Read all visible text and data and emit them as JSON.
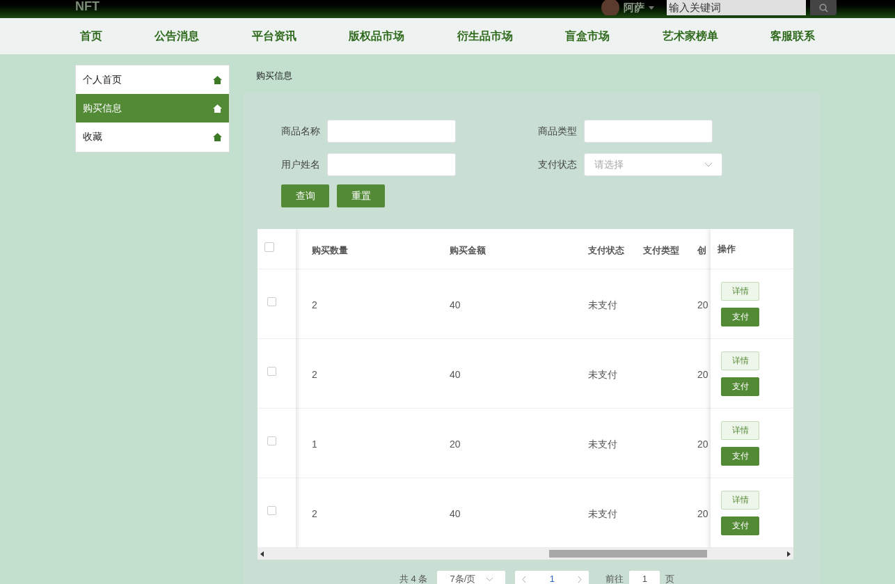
{
  "header": {
    "logo": "NFT",
    "user": "阿萨",
    "search": {
      "placeholder": "输入关键词"
    }
  },
  "nav": [
    "首页",
    "公告消息",
    "平台资讯",
    "版权品市场",
    "衍生品市场",
    "盲盒市场",
    "艺术家榜单",
    "客服联系"
  ],
  "sidebar": {
    "items": [
      {
        "label": "个人首页",
        "selected": false
      },
      {
        "label": "购买信息",
        "selected": true
      },
      {
        "label": "收藏",
        "selected": false
      }
    ]
  },
  "breadcrumb": "购买信息",
  "filters": [
    {
      "label": "商品名称",
      "kind": "text"
    },
    {
      "label": "商品类型",
      "kind": "text"
    },
    {
      "label": "用户姓名",
      "kind": "text"
    },
    {
      "label": "支付状态",
      "kind": "select",
      "placeholder": "请选择"
    }
  ],
  "buttons": [
    "查询",
    "重置"
  ],
  "table": {
    "all_checked": false,
    "columns": [
      "购买数量",
      "购买金额",
      "支付状态",
      "支付类型",
      "创",
      "操作"
    ],
    "rows": [
      {
        "cells": [
          "2",
          "40",
          "未支付",
          "",
          "20"
        ],
        "checked": false,
        "actions": [
          "详情",
          "支付"
        ]
      },
      {
        "cells": [
          "2",
          "40",
          "未支付",
          "",
          "20"
        ],
        "checked": false,
        "actions": [
          "详情",
          "支付"
        ]
      },
      {
        "cells": [
          "1",
          "20",
          "未支付",
          "",
          "20"
        ],
        "checked": false,
        "actions": [
          "详情",
          "支付"
        ]
      },
      {
        "cells": [
          "2",
          "40",
          "未支付",
          "",
          "20"
        ],
        "checked": false,
        "actions": [
          "详情",
          "支付"
        ]
      }
    ]
  },
  "pagination": {
    "total": "共 4 条",
    "page_size": "7条/页",
    "current": "1",
    "goto_label": "前往",
    "goto_value": "1",
    "page_suffix": "页"
  }
}
